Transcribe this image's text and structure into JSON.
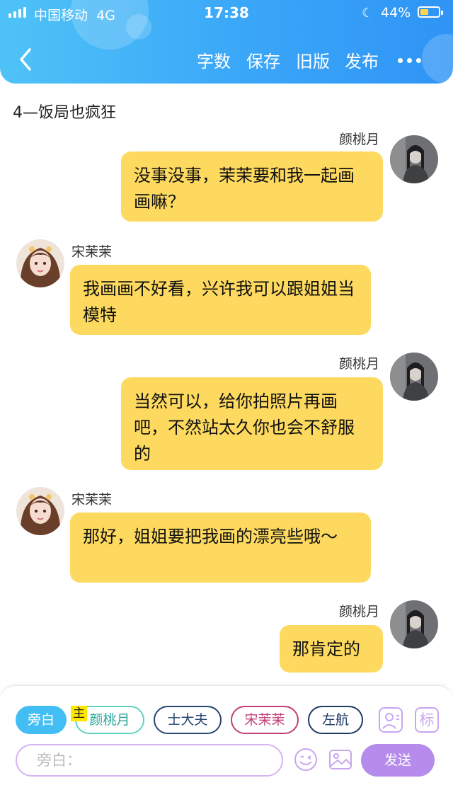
{
  "status_bar": {
    "carrier": "中国移动",
    "network": "4G",
    "time": "17:38",
    "battery_percent": "44%",
    "battery_level": 0.44
  },
  "nav": {
    "word_count": "字数",
    "save": "保存",
    "old_version": "旧版",
    "publish": "发布"
  },
  "chapter_title": "4—饭局也疯狂",
  "messages": [
    {
      "speaker": "颜桃月",
      "text": "没事没事，茉茉要和我一起画画嘛？"
    },
    {
      "speaker": "宋茉茉",
      "text": "我画画不好看，兴许我可以跟姐姐当模特"
    },
    {
      "speaker": "颜桃月",
      "text": "当然可以，给你拍照片再画吧，不然站太久你也会不舒服的"
    },
    {
      "speaker": "宋茉茉",
      "text": "那好，姐姐要把我画的漂亮些哦～"
    },
    {
      "speaker": "颜桃月",
      "text": "那肯定的"
    }
  ],
  "roles": {
    "narration": "旁白",
    "main_badge": "主",
    "items": [
      "颜桃月",
      "士大夫",
      "宋茉茉",
      "左航"
    ],
    "mark_button": "标"
  },
  "composer": {
    "placeholder": "旁白：",
    "send": "发送"
  },
  "colors": {
    "header_gradient_start": "#4fc3f7",
    "header_gradient_end": "#2f94f6",
    "bubble": "#fdd95f",
    "chip_active": "#42bef5",
    "send_button": "#b58cec"
  }
}
